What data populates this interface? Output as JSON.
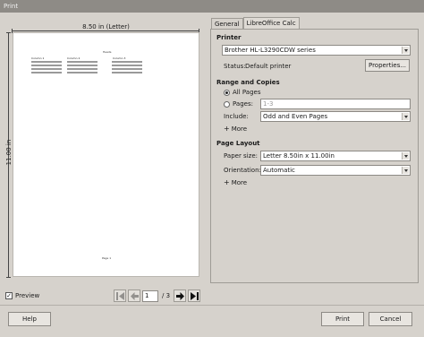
{
  "window": {
    "title": "Print"
  },
  "preview": {
    "paper_width_label": "8.50 in (Letter)",
    "paper_height_label": "11.00 in",
    "page_content": {
      "header": "Heads",
      "columns": [
        "Column 1",
        "Column 2",
        "Column 3"
      ],
      "footer": "Page 1"
    },
    "preview_checkbox_label": "Preview",
    "preview_checked": true,
    "current_page": "1",
    "page_count": "/ 3"
  },
  "tabs": [
    {
      "label": "General",
      "active": true
    },
    {
      "label": "LibreOffice Calc",
      "active": false
    }
  ],
  "printer": {
    "section_title": "Printer",
    "selected_printer": "Brother HL-L3290CDW series",
    "status_label": "Status:",
    "status_value": "Default printer",
    "properties_button": "Properties..."
  },
  "range": {
    "section_title": "Range and Copies",
    "all_pages_label": "All Pages",
    "all_pages_selected": true,
    "pages_label": "Pages:",
    "pages_value": "1-3",
    "include_label": "Include:",
    "include_value": "Odd and Even Pages",
    "more_label": "More"
  },
  "layout": {
    "section_title": "Page Layout",
    "paper_size_label": "Paper size:",
    "paper_size_value": "Letter 8.50in x 11.00in",
    "orientation_label": "Orientation:",
    "orientation_value": "Automatic",
    "more_label": "More"
  },
  "footer": {
    "help_button": "Help",
    "print_button": "Print",
    "cancel_button": "Cancel"
  }
}
